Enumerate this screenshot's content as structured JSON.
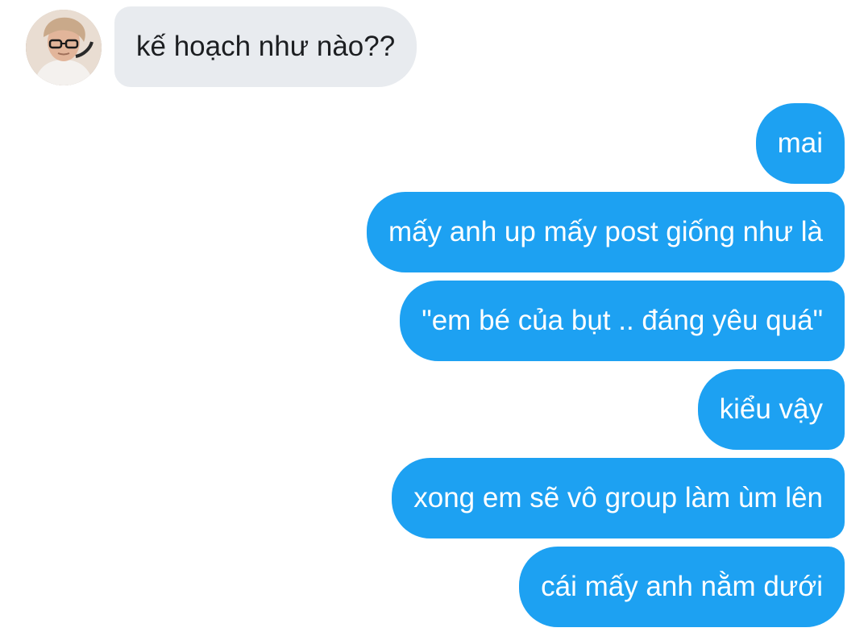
{
  "conversation": {
    "received": [
      {
        "text": "kế hoạch như nào??"
      }
    ],
    "sent": [
      {
        "text": "mai"
      },
      {
        "text": "mấy anh up mấy post giống như là"
      },
      {
        "text": "\"em bé của bụt .. đáng yêu quá\""
      },
      {
        "text": "kiểu vậy"
      },
      {
        "text": "xong em sẽ vô group làm ùm lên"
      },
      {
        "text": "cái mấy anh nằm dưới"
      }
    ]
  },
  "colors": {
    "sent_bubble": "#1da1f2",
    "received_bubble": "#e8ebef",
    "sent_text": "#ffffff",
    "received_text": "#1c1e21"
  }
}
